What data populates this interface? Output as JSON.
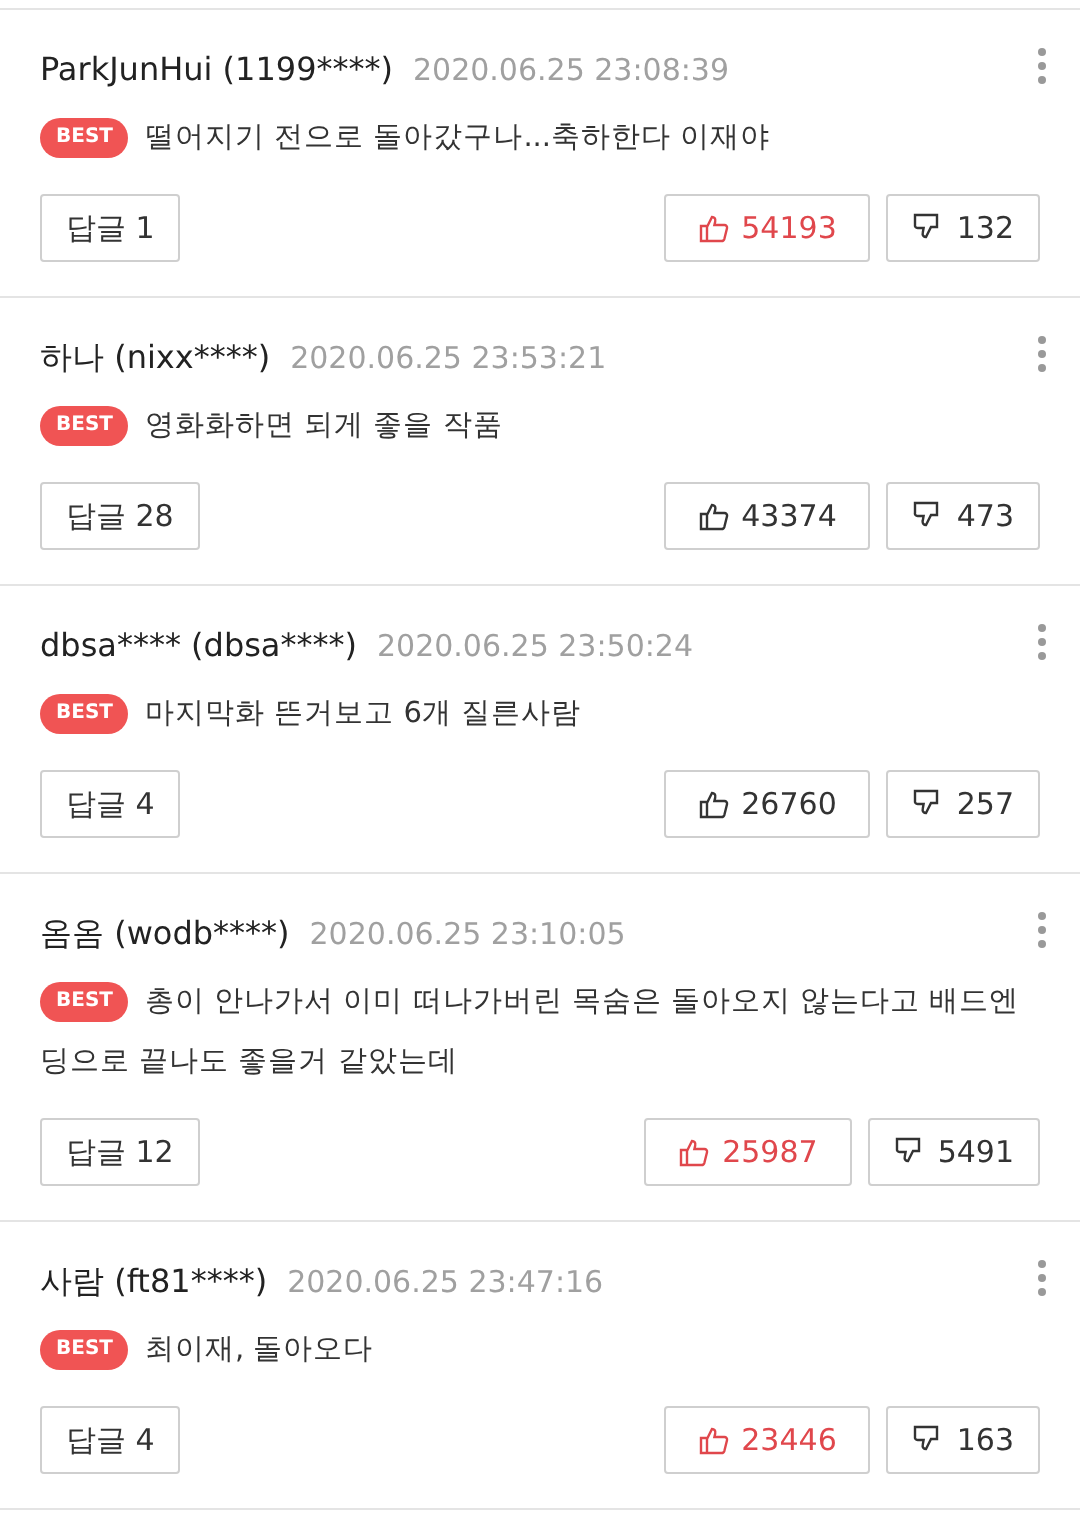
{
  "comments": [
    {
      "author": "ParkJunHui (1199****)",
      "time": "2020.06.25 23:08:39",
      "badge": "BEST",
      "text": "떨어지기 전으로 돌아갔구나...축하한다 이재야",
      "reply": "답글 1",
      "likes": "54193",
      "liked": true,
      "dislikes": "132"
    },
    {
      "author": "하나 (nixx****)",
      "time": "2020.06.25 23:53:21",
      "badge": "BEST",
      "text": "영화화하면 되게 좋을 작품",
      "reply": "답글 28",
      "likes": "43374",
      "liked": false,
      "dislikes": "473"
    },
    {
      "author": "dbsa**** (dbsa****)",
      "time": "2020.06.25 23:50:24",
      "badge": "BEST",
      "text": "마지막화 뜬거보고 6개 질른사람",
      "reply": "답글 4",
      "likes": "26760",
      "liked": false,
      "dislikes": "257"
    },
    {
      "author": "옴옴 (wodb****)",
      "time": "2020.06.25 23:10:05",
      "badge": "BEST",
      "text": "총이 안나가서 이미 떠나가버린 목숨은 돌아오지 않는다고 배드엔딩으로 끝나도 좋을거 같았는데",
      "reply": "답글 12",
      "likes": "25987",
      "liked": true,
      "dislikes": "5491"
    },
    {
      "author": "사람 (ft81****)",
      "time": "2020.06.25 23:47:16",
      "badge": "BEST",
      "text": "최이재, 돌아오다",
      "reply": "답글 4",
      "likes": "23446",
      "liked": true,
      "dislikes": "163"
    }
  ]
}
